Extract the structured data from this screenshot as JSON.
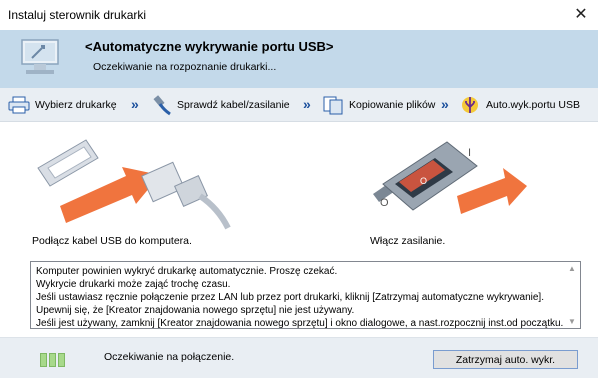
{
  "window": {
    "title": "Instaluj sterownik drukarki",
    "close_glyph": "✕"
  },
  "banner": {
    "title": "<Automatyczne wykrywanie portu USB>",
    "subtitle": "Oczekiwanie na rozpoznanie drukarki..."
  },
  "steps": [
    {
      "label": "Wybierz drukarkę",
      "icon": "printer-icon"
    },
    {
      "label": "Sprawdź kabel/zasilanie",
      "icon": "cable-icon"
    },
    {
      "label": "Kopiowanie plików",
      "icon": "copy-files-icon"
    },
    {
      "label": "Auto.wyk.portu USB",
      "icon": "usb-icon"
    }
  ],
  "instructions": {
    "usb_caption": "Podłącz kabel USB do komputera.",
    "power_caption": "Włącz zasilanie."
  },
  "message_lines": [
    "Komputer powinien wykryć drukarkę automatycznie. Proszę czekać.",
    "Wykrycie drukarki może zająć trochę czasu.",
    "Jeśli ustawiasz ręcznie połączenie przez LAN lub przez port drukarki, kliknij [Zatrzymaj automatyczne wykrywanie].",
    "Upewnij się, że [Kreator znajdowania nowego sprzętu] nie jest używany.",
    "Jeśli jest używany, zamknij [Kreator znajdowania nowego sprzętu] i okno dialogowe, a nast.rozpocznij inst.od początku."
  ],
  "footer": {
    "status": "Oczekiwanie na połączenie.",
    "stop_button": "Zatrzymaj auto. wykr."
  },
  "colors": {
    "banner": "#c3d9ea",
    "arrow": "#f0743e",
    "accent": "#1a4f9c"
  }
}
